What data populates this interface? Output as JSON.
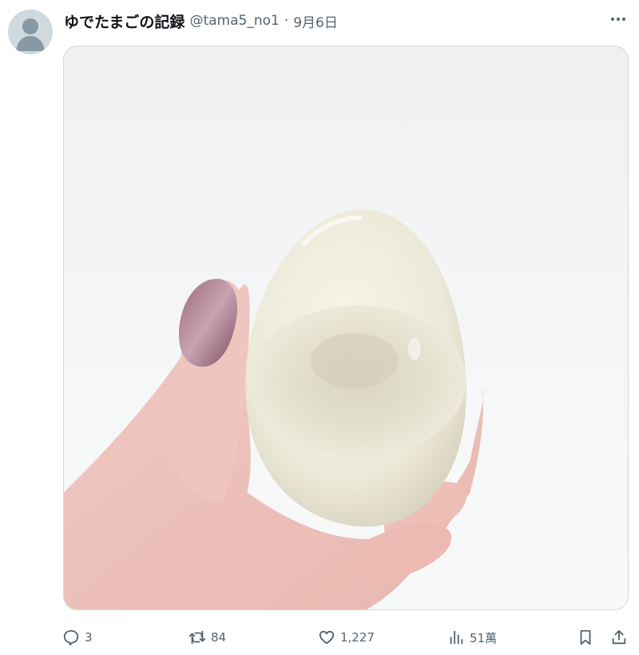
{
  "tweet": {
    "display_name": "ゆでたまごの記録",
    "handle": "@tama5_no1",
    "separator": "·",
    "date": "9月6日"
  },
  "media": {
    "subject": "peeled boiled egg with hollow held in hand"
  },
  "actions": {
    "reply_count": "3",
    "retweet_count": "84",
    "like_count": "1,227",
    "view_count": "51萬"
  },
  "icons": {
    "avatar": "default-avatar-icon",
    "more": "more-dots-icon",
    "reply": "reply-bubble-icon",
    "retweet": "retweet-icon",
    "like": "heart-icon",
    "views": "analytics-bars-icon",
    "bookmark": "bookmark-icon",
    "share": "share-icon"
  },
  "colors": {
    "muted_text": "#536471",
    "avatar_bg": "#cfd9de",
    "border": "#cfd9de"
  }
}
